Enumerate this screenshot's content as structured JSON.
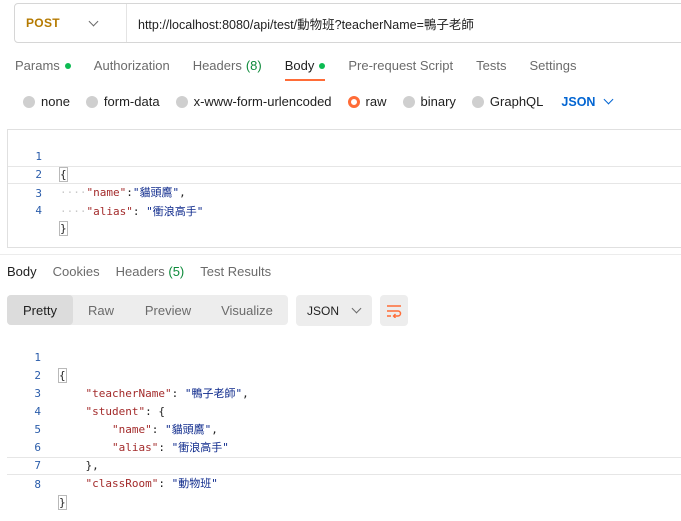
{
  "request": {
    "method": "POST",
    "url": "http://localhost:8080/api/test/動物班?teacherName=鴨子老師"
  },
  "request_tabs": [
    {
      "label": "Params",
      "count": "",
      "dot": true,
      "active": false
    },
    {
      "label": "Authorization",
      "count": "",
      "dot": false,
      "active": false
    },
    {
      "label": "Headers",
      "count": "(8)",
      "dot": false,
      "active": false
    },
    {
      "label": "Body",
      "count": "",
      "dot": true,
      "active": true
    },
    {
      "label": "Pre-request Script",
      "count": "",
      "dot": false,
      "active": false
    },
    {
      "label": "Tests",
      "count": "",
      "dot": false,
      "active": false
    },
    {
      "label": "Settings",
      "count": "",
      "dot": false,
      "active": false
    }
  ],
  "body_types": [
    "none",
    "form-data",
    "x-www-form-urlencoded",
    "raw",
    "binary",
    "GraphQL"
  ],
  "body_type_selected": "raw",
  "body_language": "JSON",
  "request_body": {
    "line_numbers": [
      "1",
      "2",
      "3",
      "4"
    ],
    "open_brace": "{",
    "name_key": "\"name\"",
    "name_value": "\"貓頭鷹\"",
    "alias_key": "\"alias\"",
    "alias_value": "\"衝浪高手\"",
    "close_brace": "}"
  },
  "response_tabs": [
    {
      "label": "Body",
      "count": "",
      "active": true
    },
    {
      "label": "Cookies",
      "count": "",
      "active": false
    },
    {
      "label": "Headers",
      "count": "(5)",
      "active": false
    },
    {
      "label": "Test Results",
      "count": "",
      "active": false
    }
  ],
  "view_modes": [
    "Pretty",
    "Raw",
    "Preview",
    "Visualize"
  ],
  "view_mode_selected": "Pretty",
  "response_format": "JSON",
  "response_body": {
    "line_numbers": [
      "1",
      "2",
      "3",
      "4",
      "5",
      "6",
      "7",
      "8"
    ],
    "open_brace": "{",
    "teacher_key": "\"teacherName\"",
    "teacher_value": "\"鴨子老師\"",
    "student_key": "\"student\"",
    "name_key": "\"name\"",
    "name_value": "\"貓頭鷹\"",
    "alias_key": "\"alias\"",
    "alias_value": "\"衝浪高手\"",
    "inner_close": "},",
    "classroom_key": "\"classRoom\"",
    "classroom_value": "\"動物班\"",
    "close_brace": "}"
  },
  "colors": {
    "accent": "#ff6c37",
    "method": "#b57a00",
    "link_blue": "#0265d2",
    "status_green": "#0cbb52"
  }
}
